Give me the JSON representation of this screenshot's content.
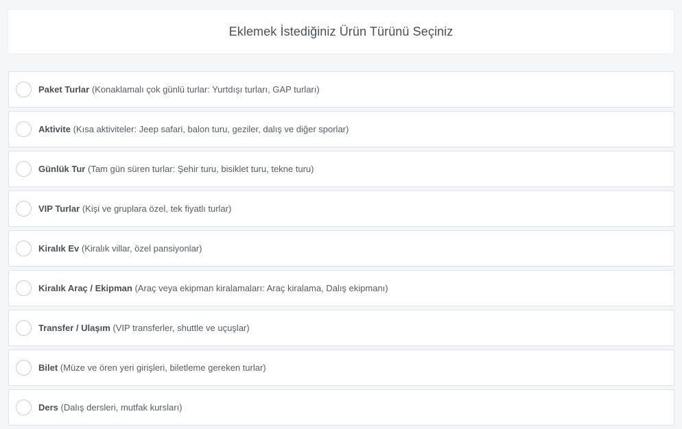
{
  "header": {
    "title": "Eklemek İstediğiniz Ürün Türünü Seçiniz"
  },
  "options": [
    {
      "name": "Paket Turlar",
      "desc": "(Konaklamalı çok günlü turlar: Yurtdışı turları, GAP turları)"
    },
    {
      "name": "Aktivite",
      "desc": "(Kısa aktiviteler: Jeep safari, balon turu, geziler, dalış ve diğer sporlar)"
    },
    {
      "name": "Günlük Tur",
      "desc": "(Tam gün süren turlar: Şehir turu, bisiklet turu, tekne turu)"
    },
    {
      "name": "VIP Turlar",
      "desc": "(Kişi ve gruplara özel, tek fiyatlı turlar)"
    },
    {
      "name": "Kiralık Ev",
      "desc": "(Kiralık villar, özel pansiyonlar)"
    },
    {
      "name": "Kiralık Araç / Ekipman",
      "desc": "(Araç veya ekipman kiralamaları: Araç kiralama, Dalış ekipmanı)"
    },
    {
      "name": "Transfer / Ulaşım",
      "desc": "(VIP transferler, shuttle ve uçuşlar)"
    },
    {
      "name": "Bilet",
      "desc": "(Müze ve ören yeri girişleri, biletleme gereken turlar)"
    },
    {
      "name": "Ders",
      "desc": "(Dalış dersleri, mutfak kursları)"
    }
  ]
}
